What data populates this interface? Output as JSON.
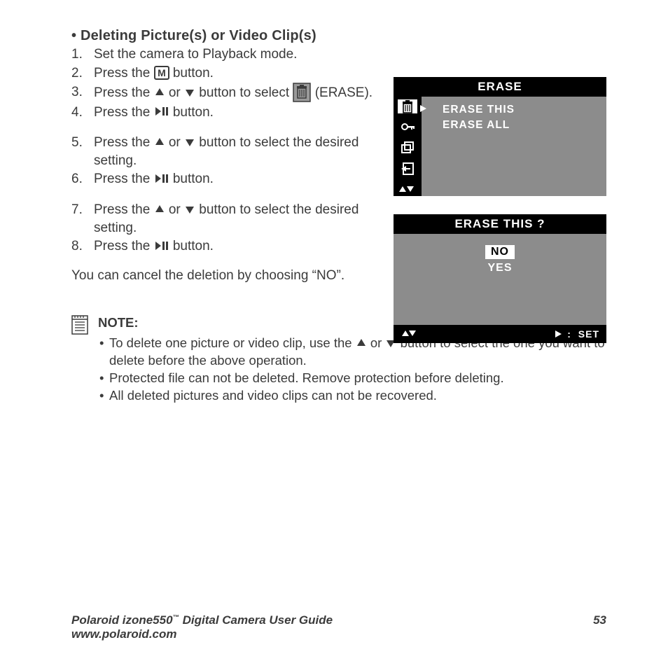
{
  "heading": "Deleting Picture(s) or Video Clip(s)",
  "steps": {
    "s1": "Set the camera to Playback mode.",
    "s2a": "Press the ",
    "s2b": " button.",
    "s3a": "Press the ",
    "s3b": " or ",
    "s3c": " button to select ",
    "s3d": " (ERASE).",
    "s4a": "Press the ",
    "s4b": " button.",
    "s5a": "Press the ",
    "s5b": " or ",
    "s5c": " button to select the desired setting.",
    "s6a": "Press the ",
    "s6b": " button.",
    "s7a": "Press the ",
    "s7b": " or ",
    "s7c": " button to select the desired setting.",
    "s8a": "Press the ",
    "s8b": " button."
  },
  "cancel": "You can cancel the deletion by choosing “NO”.",
  "note": {
    "head": "NOTE:",
    "l1a": "To delete one picture or video clip, use the ",
    "l1b": " or ",
    "l1c": " button to select the one you want to delete before the above operation.",
    "l2": "Protected file can not be deleted. Remove protection before deleting.",
    "l3": "All deleted pictures and video clips can not be recovered."
  },
  "lcd1": {
    "title": "ERASE",
    "opt1": "ERASE THIS",
    "opt2": "ERASE ALL"
  },
  "lcd2": {
    "title": "ERASE THIS ?",
    "no": "NO",
    "yes": "YES",
    "set": "SET"
  },
  "footer": {
    "line1a": "Polaroid izone550",
    "line1b": " Digital Camera User Guide",
    "line2": "www.polaroid.com",
    "page": "53"
  }
}
